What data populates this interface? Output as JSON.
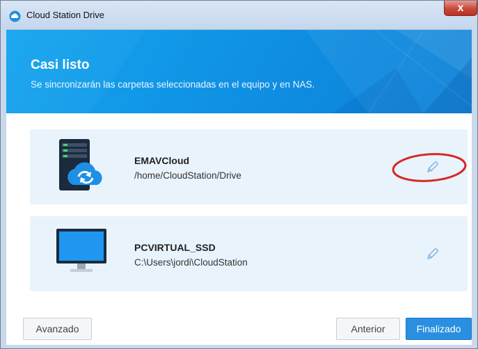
{
  "window": {
    "title": "Cloud Station Drive",
    "close_label": "x"
  },
  "banner": {
    "title": "Casi listo",
    "subtitle": "Se sincronizarán las carpetas seleccionadas en el equipo y en NAS."
  },
  "nas": {
    "name": "EMAVCloud",
    "path": "/home/CloudStation/Drive",
    "icon": "nas-cloud-sync-icon",
    "edit_icon": "pencil-icon"
  },
  "pc": {
    "name": "PCVIRTUAL_SSD",
    "path": "C:\\Users\\jordi\\CloudStation",
    "icon": "monitor-icon",
    "edit_icon": "pencil-icon"
  },
  "footer": {
    "advanced_label": "Avanzado",
    "previous_label": "Anterior",
    "finish_label": "Finalizado"
  },
  "colors": {
    "banner": "#0f8fe3",
    "card": "#e9f3fb",
    "primary_button": "#2a8fe0",
    "annotation": "#d42a25"
  }
}
